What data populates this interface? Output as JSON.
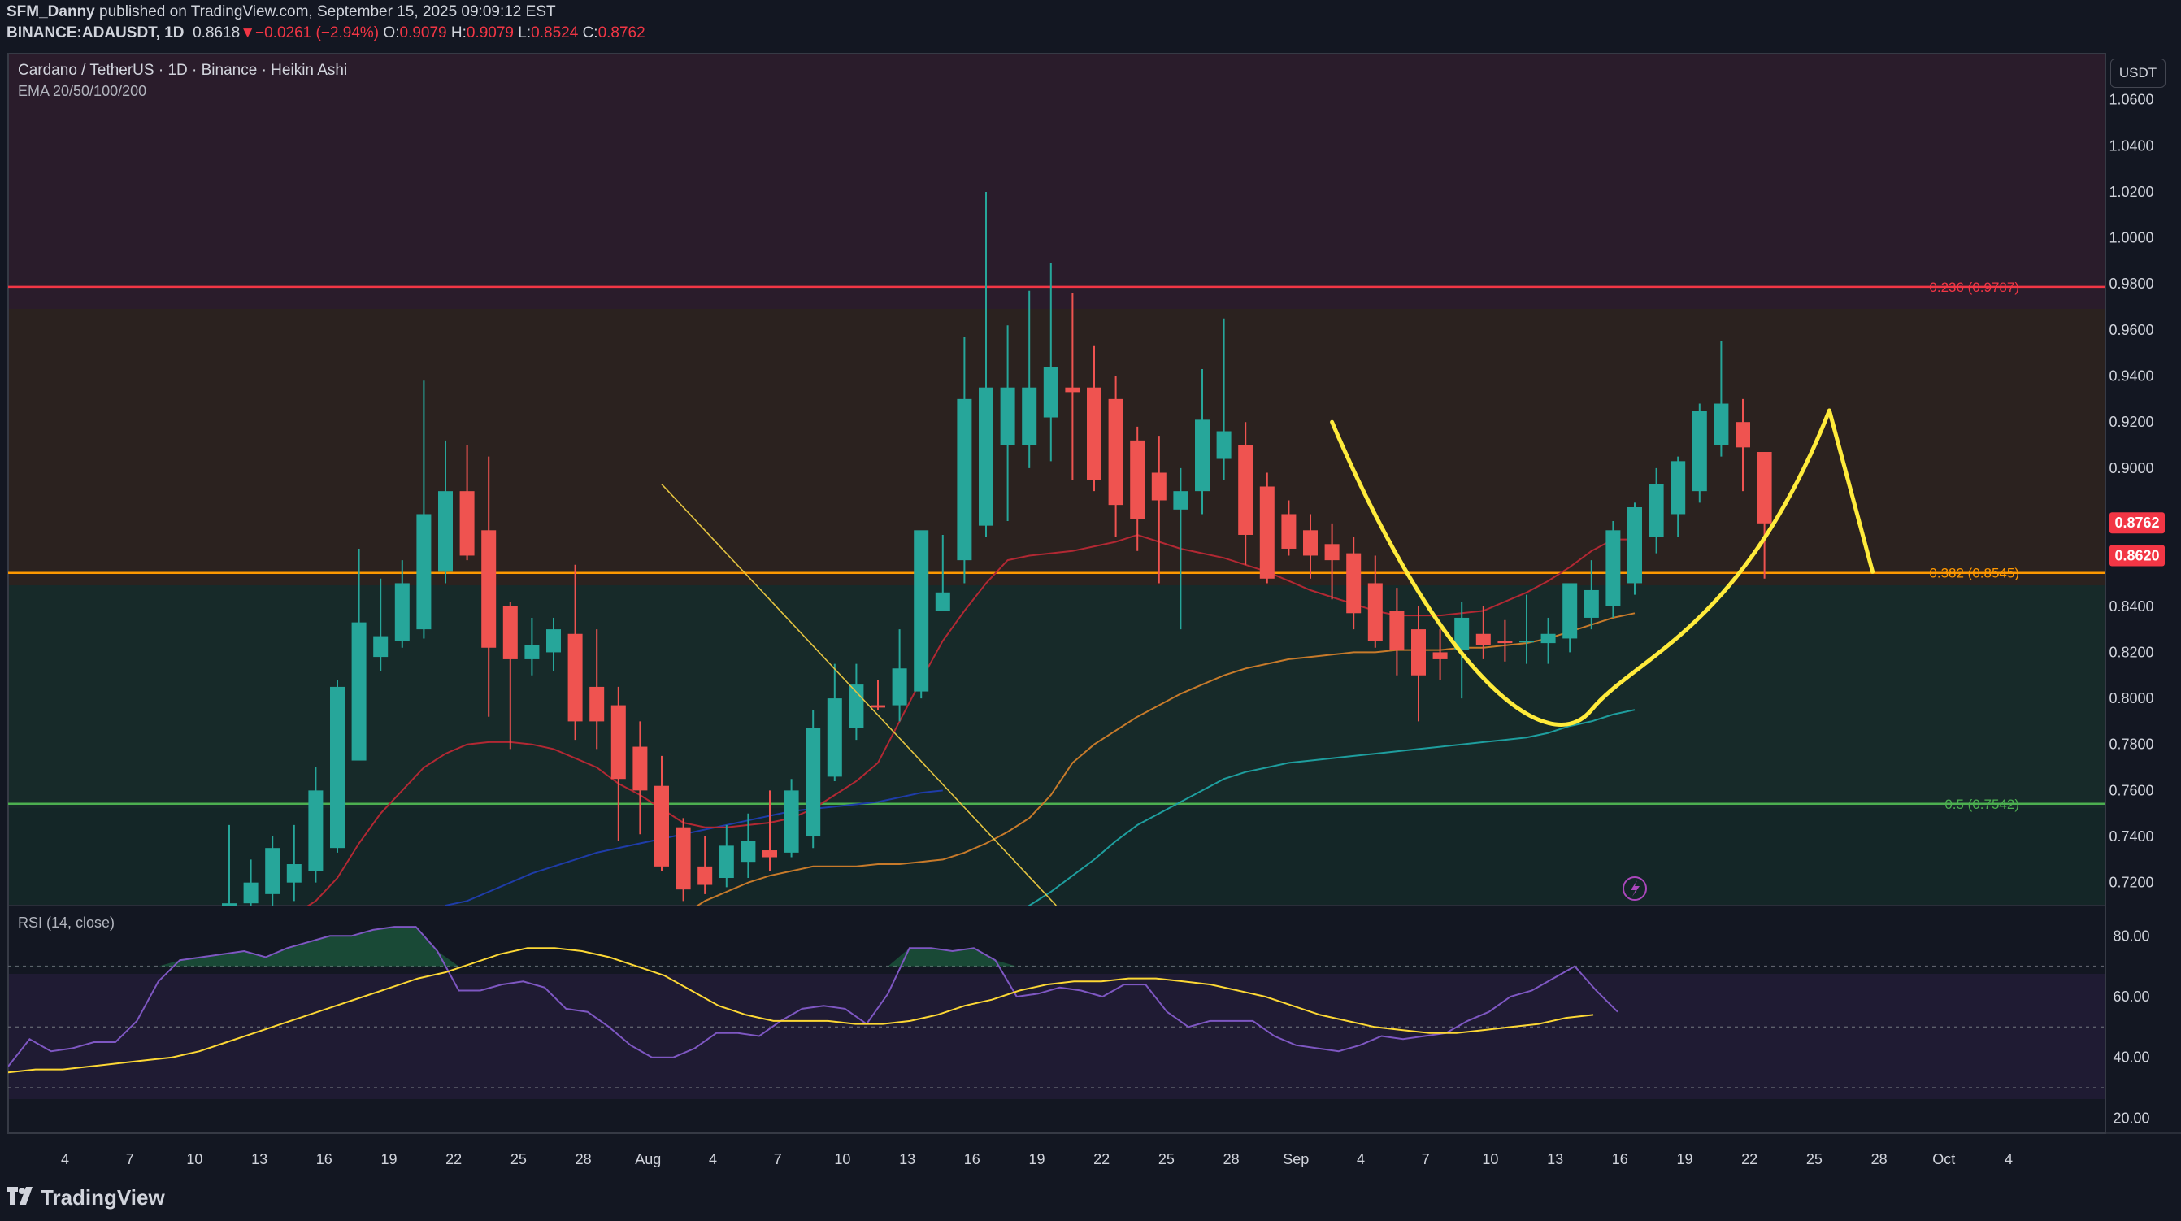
{
  "header": {
    "author": "SFM_Danny",
    "published": "published on TradingView.com, September 15, 2025 09:09:12 EST",
    "symbol": "BINANCE:ADAUSDT, 1D",
    "last": "0.8618",
    "arrow": "▼",
    "change": "−0.0261 (−2.94%)",
    "o_label": "O:",
    "o_val": "0.9079",
    "h_label": "H:",
    "h_val": "0.9079",
    "l_label": "L:",
    "l_val": "0.8524",
    "c_label": "C:",
    "c_val": "0.8762"
  },
  "legend": {
    "title": "Cardano / TetherUS · 1D · Binance · Heikin Ashi",
    "ema": "EMA 20/50/100/200",
    "rsi": "RSI (14, close)"
  },
  "currency_button": "USDT",
  "footer": {
    "brand": "TradingView",
    "icon": "tradingview-logo-icon"
  },
  "colors": {
    "up": "#26a69a",
    "down": "#ef5350",
    "background": "#131722",
    "fib_0236": "#f23645",
    "fib_0382": "#ff9800",
    "fib_05": "#4caf50",
    "ema20": "#b22833",
    "ema50": "#c77a2a",
    "ema100": "#1e9e9e",
    "ema200": "#1e3ca8",
    "rsi": "#7e57c2",
    "rsi_ma": "#fdd835",
    "drawing": "#ffeb3b"
  },
  "chart_data": {
    "type": "candlestick",
    "style": "Heikin Ashi",
    "x_ticks": [
      "4",
      "7",
      "10",
      "13",
      "16",
      "19",
      "22",
      "25",
      "28",
      "Aug",
      "4",
      "7",
      "10",
      "13",
      "16",
      "19",
      "22",
      "25",
      "28",
      "Sep",
      "4",
      "7",
      "10",
      "13",
      "16",
      "19",
      "22",
      "25",
      "28",
      "Oct",
      "4"
    ],
    "y_ticks": [
      "1.0600",
      "1.0400",
      "1.0200",
      "1.0000",
      "0.9800",
      "0.9600",
      "0.9400",
      "0.9200",
      "0.9000",
      "0.8400",
      "0.8200",
      "0.8000",
      "0.7800",
      "0.7600",
      "0.7400",
      "0.7200"
    ],
    "ylim": [
      0.71,
      1.08
    ],
    "candles": [
      {
        "d": "Jul 3",
        "o": 0.71,
        "h": 0.745,
        "l": 0.7,
        "c": 0.711
      },
      {
        "d": "Jul 4",
        "o": 0.711,
        "h": 0.73,
        "l": 0.7,
        "c": 0.72
      },
      {
        "d": "Jul 5",
        "o": 0.715,
        "h": 0.74,
        "l": 0.708,
        "c": 0.735
      },
      {
        "d": "Jul 6",
        "o": 0.72,
        "h": 0.745,
        "l": 0.712,
        "c": 0.728
      },
      {
        "d": "Jul 7",
        "o": 0.725,
        "h": 0.77,
        "l": 0.72,
        "c": 0.76
      },
      {
        "d": "Jul 8",
        "o": 0.735,
        "h": 0.808,
        "l": 0.733,
        "c": 0.805
      },
      {
        "d": "Jul 9",
        "o": 0.773,
        "h": 0.865,
        "l": 0.773,
        "c": 0.833
      },
      {
        "d": "Jul 10",
        "o": 0.818,
        "h": 0.852,
        "l": 0.812,
        "c": 0.827
      },
      {
        "d": "Jul 11",
        "o": 0.825,
        "h": 0.86,
        "l": 0.822,
        "c": 0.85
      },
      {
        "d": "Jul 12",
        "o": 0.83,
        "h": 0.938,
        "l": 0.826,
        "c": 0.88
      },
      {
        "d": "Jul 13",
        "o": 0.855,
        "h": 0.912,
        "l": 0.85,
        "c": 0.89
      },
      {
        "d": "Jul 14",
        "o": 0.89,
        "h": 0.91,
        "l": 0.86,
        "c": 0.862
      },
      {
        "d": "Jul 15",
        "o": 0.873,
        "h": 0.905,
        "l": 0.792,
        "c": 0.822
      },
      {
        "d": "Jul 16",
        "o": 0.84,
        "h": 0.842,
        "l": 0.778,
        "c": 0.817
      },
      {
        "d": "Jul 17",
        "o": 0.817,
        "h": 0.835,
        "l": 0.81,
        "c": 0.823
      },
      {
        "d": "Jul 18",
        "o": 0.82,
        "h": 0.835,
        "l": 0.812,
        "c": 0.83
      },
      {
        "d": "Jul 19",
        "o": 0.828,
        "h": 0.858,
        "l": 0.782,
        "c": 0.79
      },
      {
        "d": "Jul 20",
        "o": 0.805,
        "h": 0.83,
        "l": 0.778,
        "c": 0.79
      },
      {
        "d": "Jul 21",
        "o": 0.797,
        "h": 0.805,
        "l": 0.738,
        "c": 0.765
      },
      {
        "d": "Jul 22",
        "o": 0.779,
        "h": 0.79,
        "l": 0.741,
        "c": 0.76
      },
      {
        "d": "Jul 23",
        "o": 0.762,
        "h": 0.775,
        "l": 0.725,
        "c": 0.727
      },
      {
        "d": "Jul 24",
        "o": 0.744,
        "h": 0.748,
        "l": 0.712,
        "c": 0.717
      },
      {
        "d": "Jul 25",
        "o": 0.727,
        "h": 0.74,
        "l": 0.715,
        "c": 0.719
      },
      {
        "d": "Jul 26",
        "o": 0.722,
        "h": 0.745,
        "l": 0.718,
        "c": 0.736
      },
      {
        "d": "Jul 27",
        "o": 0.729,
        "h": 0.75,
        "l": 0.722,
        "c": 0.738
      },
      {
        "d": "Jul 28",
        "o": 0.734,
        "h": 0.76,
        "l": 0.725,
        "c": 0.731
      },
      {
        "d": "Jul 29",
        "o": 0.733,
        "h": 0.765,
        "l": 0.731,
        "c": 0.76
      },
      {
        "d": "Jul 30",
        "o": 0.74,
        "h": 0.795,
        "l": 0.735,
        "c": 0.787
      },
      {
        "d": "Jul 31",
        "o": 0.766,
        "h": 0.815,
        "l": 0.764,
        "c": 0.8
      },
      {
        "d": "Aug 1",
        "o": 0.787,
        "h": 0.815,
        "l": 0.782,
        "c": 0.806
      },
      {
        "d": "Aug 2",
        "o": 0.797,
        "h": 0.808,
        "l": 0.795,
        "c": 0.796
      },
      {
        "d": "Aug 3",
        "o": 0.797,
        "h": 0.83,
        "l": 0.79,
        "c": 0.813
      },
      {
        "d": "Aug 4",
        "o": 0.803,
        "h": 0.852,
        "l": 0.8,
        "c": 0.873
      },
      {
        "d": "Aug 5",
        "o": 0.838,
        "h": 0.871,
        "l": 0.838,
        "c": 0.846
      },
      {
        "d": "Aug 6",
        "o": 0.86,
        "h": 0.957,
        "l": 0.85,
        "c": 0.93
      },
      {
        "d": "Aug 7",
        "o": 0.875,
        "h": 1.02,
        "l": 0.87,
        "c": 0.935
      },
      {
        "d": "Aug 8",
        "o": 0.91,
        "h": 0.962,
        "l": 0.877,
        "c": 0.935
      },
      {
        "d": "Aug 9",
        "o": 0.91,
        "h": 0.977,
        "l": 0.9,
        "c": 0.935
      },
      {
        "d": "Aug 10",
        "o": 0.922,
        "h": 0.989,
        "l": 0.903,
        "c": 0.944
      },
      {
        "d": "Aug 11",
        "o": 0.935,
        "h": 0.976,
        "l": 0.895,
        "c": 0.933
      },
      {
        "d": "Aug 12",
        "o": 0.935,
        "h": 0.953,
        "l": 0.89,
        "c": 0.895
      },
      {
        "d": "Aug 13",
        "o": 0.93,
        "h": 0.94,
        "l": 0.87,
        "c": 0.884
      },
      {
        "d": "Aug 14",
        "o": 0.912,
        "h": 0.918,
        "l": 0.864,
        "c": 0.878
      },
      {
        "d": "Aug 15",
        "o": 0.898,
        "h": 0.914,
        "l": 0.85,
        "c": 0.886
      },
      {
        "d": "Aug 16",
        "o": 0.882,
        "h": 0.9,
        "l": 0.83,
        "c": 0.89
      },
      {
        "d": "Aug 17",
        "o": 0.89,
        "h": 0.943,
        "l": 0.88,
        "c": 0.921
      },
      {
        "d": "Aug 18",
        "o": 0.904,
        "h": 0.965,
        "l": 0.895,
        "c": 0.916
      },
      {
        "d": "Aug 19",
        "o": 0.91,
        "h": 0.92,
        "l": 0.858,
        "c": 0.871
      },
      {
        "d": "Aug 20",
        "o": 0.892,
        "h": 0.898,
        "l": 0.85,
        "c": 0.852
      },
      {
        "d": "Aug 21",
        "o": 0.88,
        "h": 0.886,
        "l": 0.862,
        "c": 0.865
      },
      {
        "d": "Aug 22",
        "o": 0.873,
        "h": 0.88,
        "l": 0.852,
        "c": 0.862
      },
      {
        "d": "Aug 23",
        "o": 0.867,
        "h": 0.876,
        "l": 0.843,
        "c": 0.86
      },
      {
        "d": "Aug 24",
        "o": 0.863,
        "h": 0.87,
        "l": 0.83,
        "c": 0.837
      },
      {
        "d": "Aug 25",
        "o": 0.85,
        "h": 0.862,
        "l": 0.822,
        "c": 0.825
      },
      {
        "d": "Aug 26",
        "o": 0.838,
        "h": 0.848,
        "l": 0.81,
        "c": 0.821
      },
      {
        "d": "Aug 27",
        "o": 0.83,
        "h": 0.84,
        "l": 0.79,
        "c": 0.81
      },
      {
        "d": "Aug 28",
        "o": 0.82,
        "h": 0.83,
        "l": 0.808,
        "c": 0.817
      },
      {
        "d": "Aug 29",
        "o": 0.821,
        "h": 0.842,
        "l": 0.8,
        "c": 0.835
      },
      {
        "d": "Aug 30",
        "o": 0.828,
        "h": 0.84,
        "l": 0.817,
        "c": 0.823
      },
      {
        "d": "Aug 31",
        "o": 0.825,
        "h": 0.834,
        "l": 0.816,
        "c": 0.824
      },
      {
        "d": "Sep 1",
        "o": 0.825,
        "h": 0.845,
        "l": 0.815,
        "c": 0.825
      },
      {
        "d": "Sep 2",
        "o": 0.824,
        "h": 0.835,
        "l": 0.815,
        "c": 0.828
      },
      {
        "d": "Sep 3",
        "o": 0.826,
        "h": 0.85,
        "l": 0.82,
        "c": 0.85
      },
      {
        "d": "Sep 4",
        "o": 0.835,
        "h": 0.86,
        "l": 0.83,
        "c": 0.847
      },
      {
        "d": "Sep 5",
        "o": 0.84,
        "h": 0.877,
        "l": 0.835,
        "c": 0.873
      },
      {
        "d": "Sep 6",
        "o": 0.85,
        "h": 0.885,
        "l": 0.845,
        "c": 0.883
      },
      {
        "d": "Sep 7",
        "o": 0.87,
        "h": 0.9,
        "l": 0.863,
        "c": 0.893
      },
      {
        "d": "Sep 8",
        "o": 0.88,
        "h": 0.905,
        "l": 0.87,
        "c": 0.903
      },
      {
        "d": "Sep 9",
        "o": 0.89,
        "h": 0.928,
        "l": 0.885,
        "c": 0.925
      },
      {
        "d": "Sep 10",
        "o": 0.91,
        "h": 0.955,
        "l": 0.905,
        "c": 0.928
      },
      {
        "d": "Sep 11",
        "o": 0.92,
        "h": 0.93,
        "l": 0.89,
        "c": 0.909
      },
      {
        "d": "Sep 12",
        "o": 0.907,
        "h": 0.907,
        "l": 0.852,
        "c": 0.876
      }
    ],
    "ema": {
      "ema20": [
        0.7,
        0.7,
        0.702,
        0.706,
        0.712,
        0.722,
        0.737,
        0.75,
        0.76,
        0.77,
        0.776,
        0.78,
        0.781,
        0.781,
        0.78,
        0.778,
        0.774,
        0.77,
        0.763,
        0.758,
        0.752,
        0.746,
        0.744,
        0.744,
        0.745,
        0.746,
        0.748,
        0.752,
        0.758,
        0.764,
        0.772,
        0.79,
        0.808,
        0.825,
        0.838,
        0.85,
        0.86,
        0.862,
        0.863,
        0.864,
        0.866,
        0.868,
        0.871,
        0.868,
        0.865,
        0.863,
        0.861,
        0.858,
        0.855,
        0.851,
        0.847,
        0.844,
        0.841,
        0.838,
        0.836,
        0.836,
        0.836,
        0.837,
        0.838,
        0.842,
        0.846,
        0.851,
        0.857,
        0.864,
        0.869,
        0.869
      ],
      "ema50": [
        0.69,
        0.69,
        0.692,
        0.695,
        0.7,
        0.706,
        0.712,
        0.716,
        0.72,
        0.723,
        0.725,
        0.727,
        0.727,
        0.727,
        0.728,
        0.728,
        0.729,
        0.73,
        0.733,
        0.737,
        0.742,
        0.748,
        0.758,
        0.772,
        0.78,
        0.786,
        0.792,
        0.797,
        0.802,
        0.806,
        0.81,
        0.813,
        0.815,
        0.817,
        0.818,
        0.819,
        0.82,
        0.82,
        0.821,
        0.821,
        0.821,
        0.822,
        0.822,
        0.823,
        0.824,
        0.826,
        0.829,
        0.832,
        0.835,
        0.837
      ],
      "ema100": [
        0.7,
        0.703,
        0.706,
        0.71,
        0.716,
        0.723,
        0.73,
        0.738,
        0.745,
        0.75,
        0.755,
        0.76,
        0.765,
        0.768,
        0.77,
        0.772,
        0.773,
        0.774,
        0.775,
        0.776,
        0.777,
        0.778,
        0.779,
        0.78,
        0.781,
        0.782,
        0.783,
        0.785,
        0.788,
        0.79,
        0.793,
        0.795
      ],
      "ema200": [
        0.71,
        0.712,
        0.716,
        0.72,
        0.724,
        0.727,
        0.73,
        0.733,
        0.735,
        0.737,
        0.739,
        0.741,
        0.743,
        0.745,
        0.747,
        0.749,
        0.751,
        0.752,
        0.753,
        0.754,
        0.755,
        0.757,
        0.759,
        0.76
      ]
    },
    "fib_levels": [
      {
        "ratio": "0.236",
        "price": 0.9787,
        "label": "0.236 (0.9787)"
      },
      {
        "ratio": "0.382",
        "price": 0.8545,
        "label": "0.382 (0.8545)"
      },
      {
        "ratio": "0.5",
        "price": 0.7542,
        "label": "0.5 (0.7542)"
      }
    ],
    "price_tags": [
      {
        "label": "0.8762",
        "price": 0.8762
      },
      {
        "label": "0.8620",
        "price": 0.862
      }
    ],
    "rsi": {
      "y_ticks": [
        "80.00",
        "60.00",
        "40.00",
        "20.00"
      ],
      "ylim": [
        15,
        90
      ],
      "bands": [
        70,
        50,
        30
      ],
      "values": [
        37,
        46,
        42,
        43,
        45,
        45,
        52,
        65,
        72,
        73,
        74,
        75,
        73,
        76,
        78,
        80,
        80,
        82,
        83,
        83,
        75,
        62,
        62,
        64,
        65,
        63,
        56,
        55,
        50,
        44,
        40,
        40,
        43,
        48,
        48,
        47,
        52,
        56,
        57,
        56,
        51,
        61,
        76,
        76,
        75,
        76,
        72,
        60,
        61,
        63,
        62,
        60,
        64,
        64,
        55,
        50,
        52,
        52,
        52,
        47,
        44,
        43,
        42,
        44,
        47,
        46,
        47,
        48,
        52,
        55,
        60,
        62,
        66,
        70,
        62,
        55
      ],
      "ma": [
        35,
        36,
        36,
        37,
        38,
        39,
        40,
        42,
        45,
        48,
        51,
        54,
        57,
        60,
        63,
        66,
        68,
        71,
        74,
        76,
        76,
        75,
        73,
        70,
        67,
        62,
        57,
        54,
        52,
        52,
        52,
        51,
        51,
        52,
        54,
        57,
        59,
        62,
        64,
        65,
        65,
        66,
        66,
        65,
        64,
        62,
        60,
        57,
        54,
        52,
        50,
        49,
        48,
        48,
        49,
        50,
        51,
        53,
        54
      ]
    },
    "drawings": {
      "downtrend_line": [
        [
          "Jul 23",
          0.893
        ],
        [
          "Aug 10",
          0.71
        ]
      ],
      "cup_curve": "yellow cup-shaped curve from Aug 23 to Sep 11",
      "breakdown_line": "yellow line from Sep 13 peak down to 0.8550"
    }
  }
}
